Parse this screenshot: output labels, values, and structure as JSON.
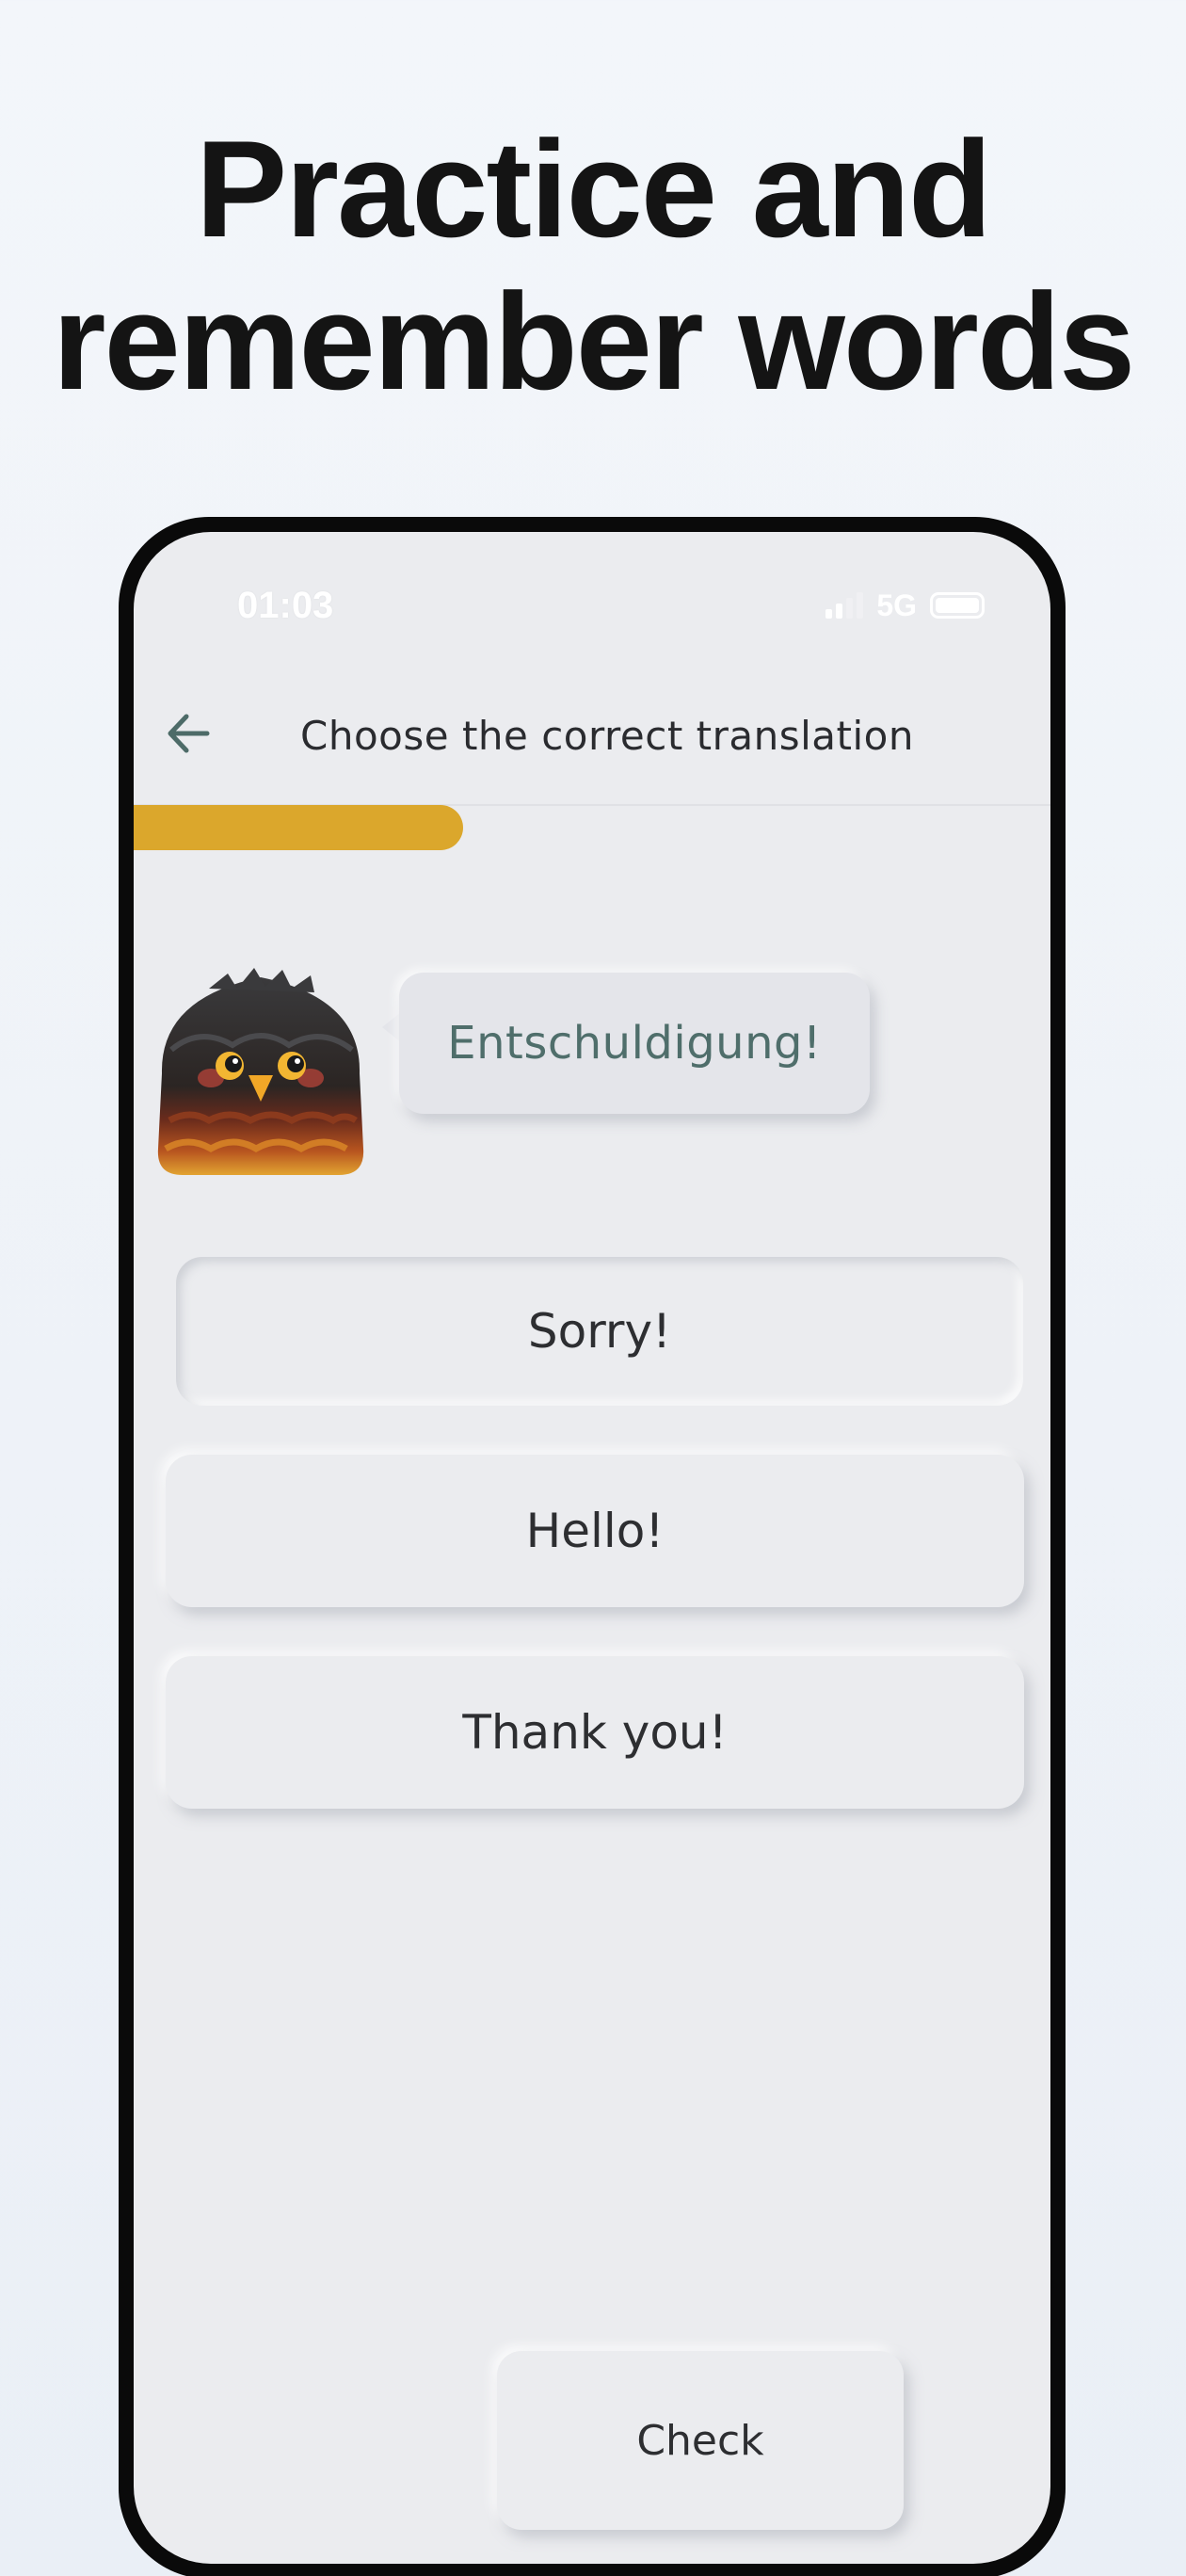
{
  "headline": {
    "line1": "Practice and",
    "line2": "remember words"
  },
  "status_bar": {
    "time": "01:03",
    "network": "5G"
  },
  "nav": {
    "title": "Choose the correct translation"
  },
  "progress": {
    "fraction": 0.38
  },
  "prompt": {
    "word": "Entschuldigung!"
  },
  "options": [
    {
      "label": "Sorry!",
      "selected": true
    },
    {
      "label": "Hello!",
      "selected": false
    },
    {
      "label": "Thank you!",
      "selected": false
    }
  ],
  "check_button": {
    "label": "Check"
  },
  "colors": {
    "accent": "#dba72c",
    "prompt_text": "#4f6e6b",
    "screen_bg": "#ebecef"
  },
  "icons": [
    "arrow-left-icon",
    "owl-mascot",
    "signal-icon",
    "battery-icon"
  ]
}
